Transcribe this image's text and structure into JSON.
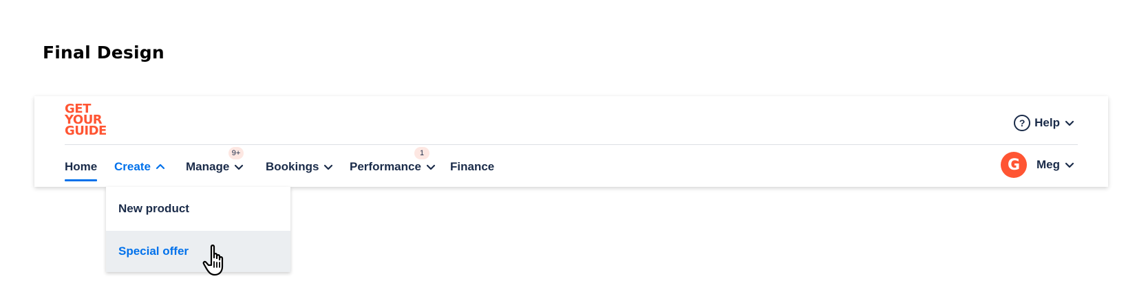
{
  "page": {
    "heading": "Final Design"
  },
  "logo": {
    "lines": [
      "GET",
      "YOUR",
      "GUIDE"
    ],
    "color": "#ff5533"
  },
  "header": {
    "help": {
      "label": "Help",
      "icon": "help-circle-icon"
    },
    "user": {
      "name": "Meg",
      "avatar_letter": "G",
      "avatar_color": "#ff5533"
    }
  },
  "nav": {
    "tabs": [
      {
        "label": "Home",
        "state": "active"
      },
      {
        "label": "Create",
        "state": "open",
        "chevron": "chevron-up-icon"
      },
      {
        "label": "Manage",
        "badge": "9+",
        "chevron": "chevron-down-icon"
      },
      {
        "label": "Bookings",
        "chevron": "chevron-down-icon"
      },
      {
        "label": "Performance",
        "badge": "1",
        "chevron": "chevron-down-icon"
      },
      {
        "label": "Finance"
      }
    ]
  },
  "create_menu": {
    "items": [
      {
        "label": "New product"
      },
      {
        "label": "Special offer",
        "state": "hover"
      }
    ]
  },
  "colors": {
    "accent": "#0071eb",
    "text": "#1a2b49",
    "brand": "#ff5533",
    "badge_bg": "#fde7e2",
    "hover_bg": "#ebeef1"
  }
}
